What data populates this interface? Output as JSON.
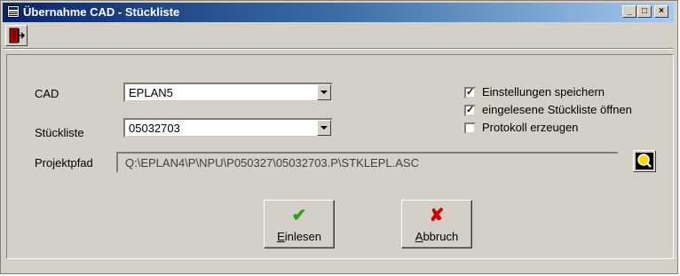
{
  "window": {
    "title": "Übernahme CAD - Stückliste",
    "controls": {
      "minimize": "_",
      "maximize": "□",
      "close": "×"
    }
  },
  "toolbar": {
    "exit_icon": "exit-door-icon"
  },
  "form": {
    "cad": {
      "label": "CAD",
      "value": "EPLAN5"
    },
    "stueckliste": {
      "label": "Stückliste",
      "value": "05032703"
    },
    "projektpfad": {
      "label": "Projektpfad",
      "value": "Q:\\EPLAN4\\P\\NPU\\P050327\\05032703.P\\STKLEPL.ASC"
    },
    "options": [
      {
        "label": "Einstellungen speichern",
        "checked": true,
        "mark": "✓"
      },
      {
        "label": "eingelesene Stückliste öffnen",
        "checked": true,
        "mark": "✓"
      },
      {
        "label": "Protokoll erzeugen",
        "checked": false,
        "mark": ""
      }
    ]
  },
  "buttons": {
    "einlesen": {
      "label": "Einlesen",
      "icon": "green-check-icon",
      "glyph": "✔",
      "color": "#2e9e1f"
    },
    "abbruch": {
      "label": "Abbruch",
      "icon": "red-x-icon",
      "glyph": "✘",
      "color": "#cc0000"
    }
  }
}
